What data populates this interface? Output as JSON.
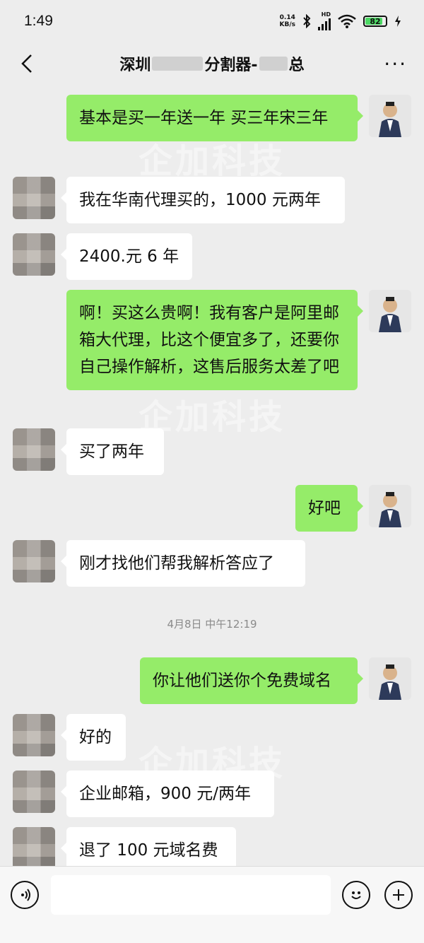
{
  "status_bar": {
    "time": "1:49",
    "net_speed_value": "0.14",
    "net_speed_unit": "KB/s",
    "network_type": "HD",
    "battery_level": "82"
  },
  "header": {
    "title_start": "深圳",
    "title_middle": "分割器-",
    "title_end": "总"
  },
  "watermark": "企加科技",
  "messages": [
    {
      "side": "self",
      "text": "基本是买一年送一年  买三年宋三年"
    },
    {
      "side": "other",
      "text": "我在华南代理买的，1000 元两年"
    },
    {
      "side": "other",
      "text": "2400.元 6 年"
    },
    {
      "side": "self",
      "text": "啊！买这么贵啊！我有客户是阿里邮箱大代理，比这个便宜多了，还要你自己操作解析，这售后服务太差了吧"
    },
    {
      "side": "other",
      "text": "买了两年"
    },
    {
      "side": "self",
      "text": "好吧"
    },
    {
      "side": "other",
      "text": "刚才找他们帮我解析答应了"
    },
    {
      "side": "self",
      "text": "你让他们送你个免费域名"
    },
    {
      "side": "other",
      "text": "好的"
    },
    {
      "side": "other",
      "text": "企业邮箱，900 元/两年"
    },
    {
      "side": "other",
      "text": "退了 100 元域名费"
    }
  ],
  "timestamp": "4月8日 中午12:19",
  "input_bar": {
    "voice_icon": "voice-icon",
    "emoji_icon": "emoji-icon",
    "plus_icon": "plus-icon"
  },
  "colors": {
    "self_bubble": "#95ec69",
    "other_bubble": "#ffffff",
    "background": "#ededed"
  }
}
